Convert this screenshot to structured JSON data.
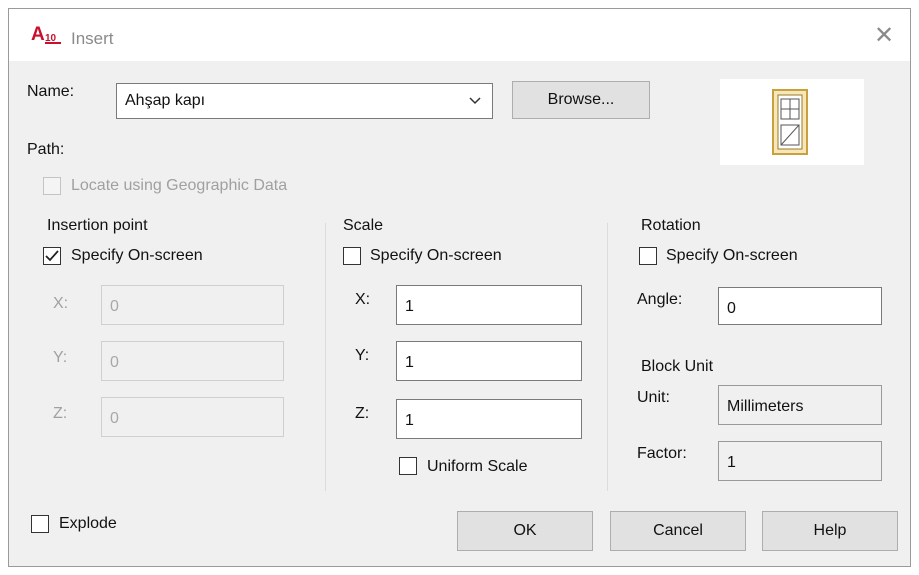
{
  "window": {
    "title": "Insert",
    "app_icon_text": "A",
    "app_icon_badge": "10"
  },
  "name": {
    "label": "Name:",
    "value": "Ahşap kapı"
  },
  "browse_label": "Browse...",
  "path_label": "Path:",
  "geo_label": "Locate using Geographic Data",
  "insertion": {
    "title": "Insertion point",
    "specify_label": "Specify On-screen",
    "specify_checked": true,
    "x_label": "X:",
    "x_value": "0",
    "y_label": "Y:",
    "y_value": "0",
    "z_label": "Z:",
    "z_value": "0"
  },
  "scale": {
    "title": "Scale",
    "specify_label": "Specify On-screen",
    "specify_checked": false,
    "x_label": "X:",
    "x_value": "1",
    "y_label": "Y:",
    "y_value": "1",
    "z_label": "Z:",
    "z_value": "1",
    "uniform_label": "Uniform Scale"
  },
  "rotation": {
    "title": "Rotation",
    "specify_label": "Specify On-screen",
    "specify_checked": false,
    "angle_label": "Angle:",
    "angle_value": "0"
  },
  "block_unit": {
    "title": "Block Unit",
    "unit_label": "Unit:",
    "unit_value": "Millimeters",
    "factor_label": "Factor:",
    "factor_value": "1"
  },
  "explode_label": "Explode",
  "buttons": {
    "ok": "OK",
    "cancel": "Cancel",
    "help": "Help"
  },
  "colors": {
    "dialog_bg": "#f0f0f0",
    "icon_red": "#c8102e",
    "preview_gold": "#c8a040"
  }
}
